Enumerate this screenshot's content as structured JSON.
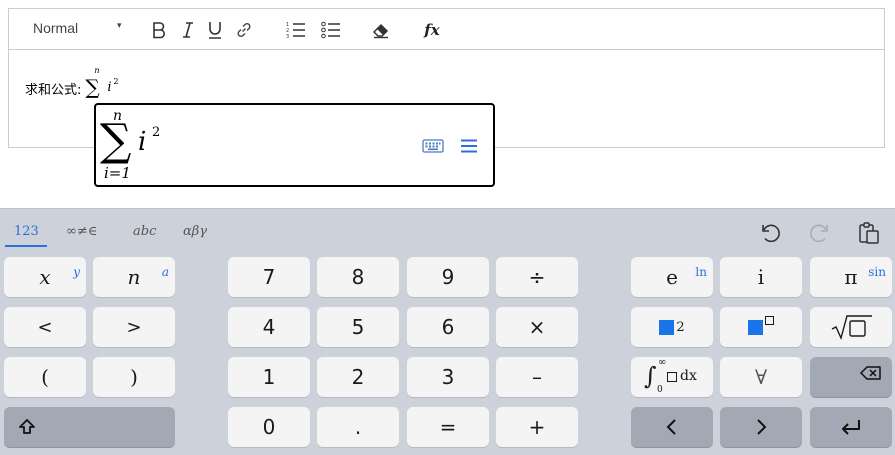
{
  "toolbar": {
    "format_label": "Normal",
    "format_caret": "▾",
    "formula_label": "fx"
  },
  "content": {
    "label": "求和公式:",
    "inline_formula": {
      "sigma": "∑",
      "upper": "n",
      "body": "i",
      "power": "2"
    }
  },
  "mathfield": {
    "sigma": "∑",
    "upper": "n",
    "lower": "i=1",
    "body": "i",
    "power": "2"
  },
  "keyboard": {
    "tabs": [
      "123",
      "∞≠∈",
      "abc",
      "αβγ"
    ],
    "active_tab": 0,
    "accent_color": "#2c6fd8",
    "keys": {
      "x": "x",
      "x_shift": "y",
      "n": "n",
      "n_shift": "a",
      "lt": "<",
      "gt": ">",
      "lparen": "(",
      "rparen": ")",
      "d7": "7",
      "d8": "8",
      "d9": "9",
      "div": "÷",
      "d4": "4",
      "d5": "5",
      "d6": "6",
      "mul": "×",
      "d1": "1",
      "d2": "2",
      "d3": "3",
      "minus": "–",
      "d0": "0",
      "dot": ".",
      "eq": "=",
      "plus": "+",
      "e": "e",
      "e_shift": "ln",
      "i": "i",
      "pi": "π",
      "pi_shift": "sin",
      "sq_exp": "2",
      "forall": "∀",
      "left": "‹",
      "right": "›"
    },
    "integral": {
      "symbol": "∫",
      "upper": "∞",
      "lower": "0",
      "dx": "dx"
    }
  }
}
